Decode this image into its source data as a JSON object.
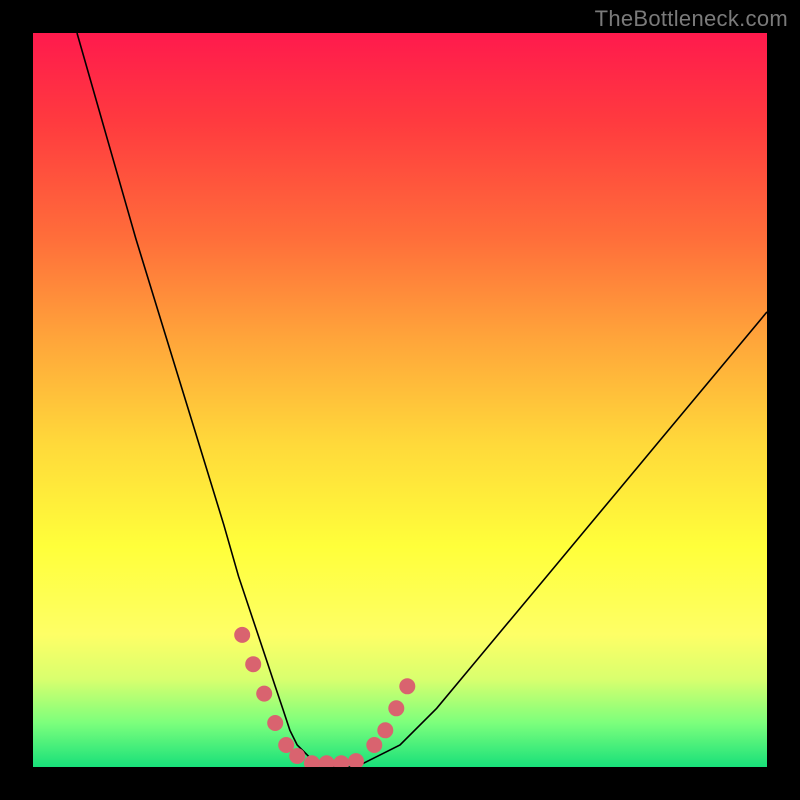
{
  "watermark": "TheBottleneck.com",
  "chart_data": {
    "type": "line",
    "title": "",
    "xlabel": "",
    "ylabel": "",
    "xlim": [
      0,
      100
    ],
    "ylim": [
      0,
      100
    ],
    "grid": false,
    "legend": false,
    "series": [
      {
        "name": "bottleneck-curve",
        "x": [
          6,
          10,
          14,
          18,
          22,
          26,
          28,
          30,
          32,
          33,
          34,
          35,
          36,
          37,
          38,
          40,
          42,
          44,
          46,
          50,
          55,
          60,
          65,
          70,
          75,
          80,
          85,
          90,
          95,
          100
        ],
        "y": [
          100,
          86,
          72,
          59,
          46,
          33,
          26,
          20,
          14,
          11,
          8,
          5,
          3,
          2,
          1,
          0,
          0,
          0,
          1,
          3,
          8,
          14,
          20,
          26,
          32,
          38,
          44,
          50,
          56,
          62
        ]
      }
    ],
    "highlight_points": {
      "name": "salmon-dots",
      "x": [
        28.5,
        30,
        31.5,
        33,
        34.5,
        36,
        38,
        40,
        42,
        44,
        46.5,
        48,
        49.5,
        51
      ],
      "y": [
        18,
        14,
        10,
        6,
        3,
        1.5,
        0.5,
        0.5,
        0.5,
        0.8,
        3,
        5,
        8,
        11
      ]
    },
    "background_gradient": {
      "top": "#ff1a4d",
      "mid": "#ffff3a",
      "bottom": "#18e07a"
    }
  }
}
